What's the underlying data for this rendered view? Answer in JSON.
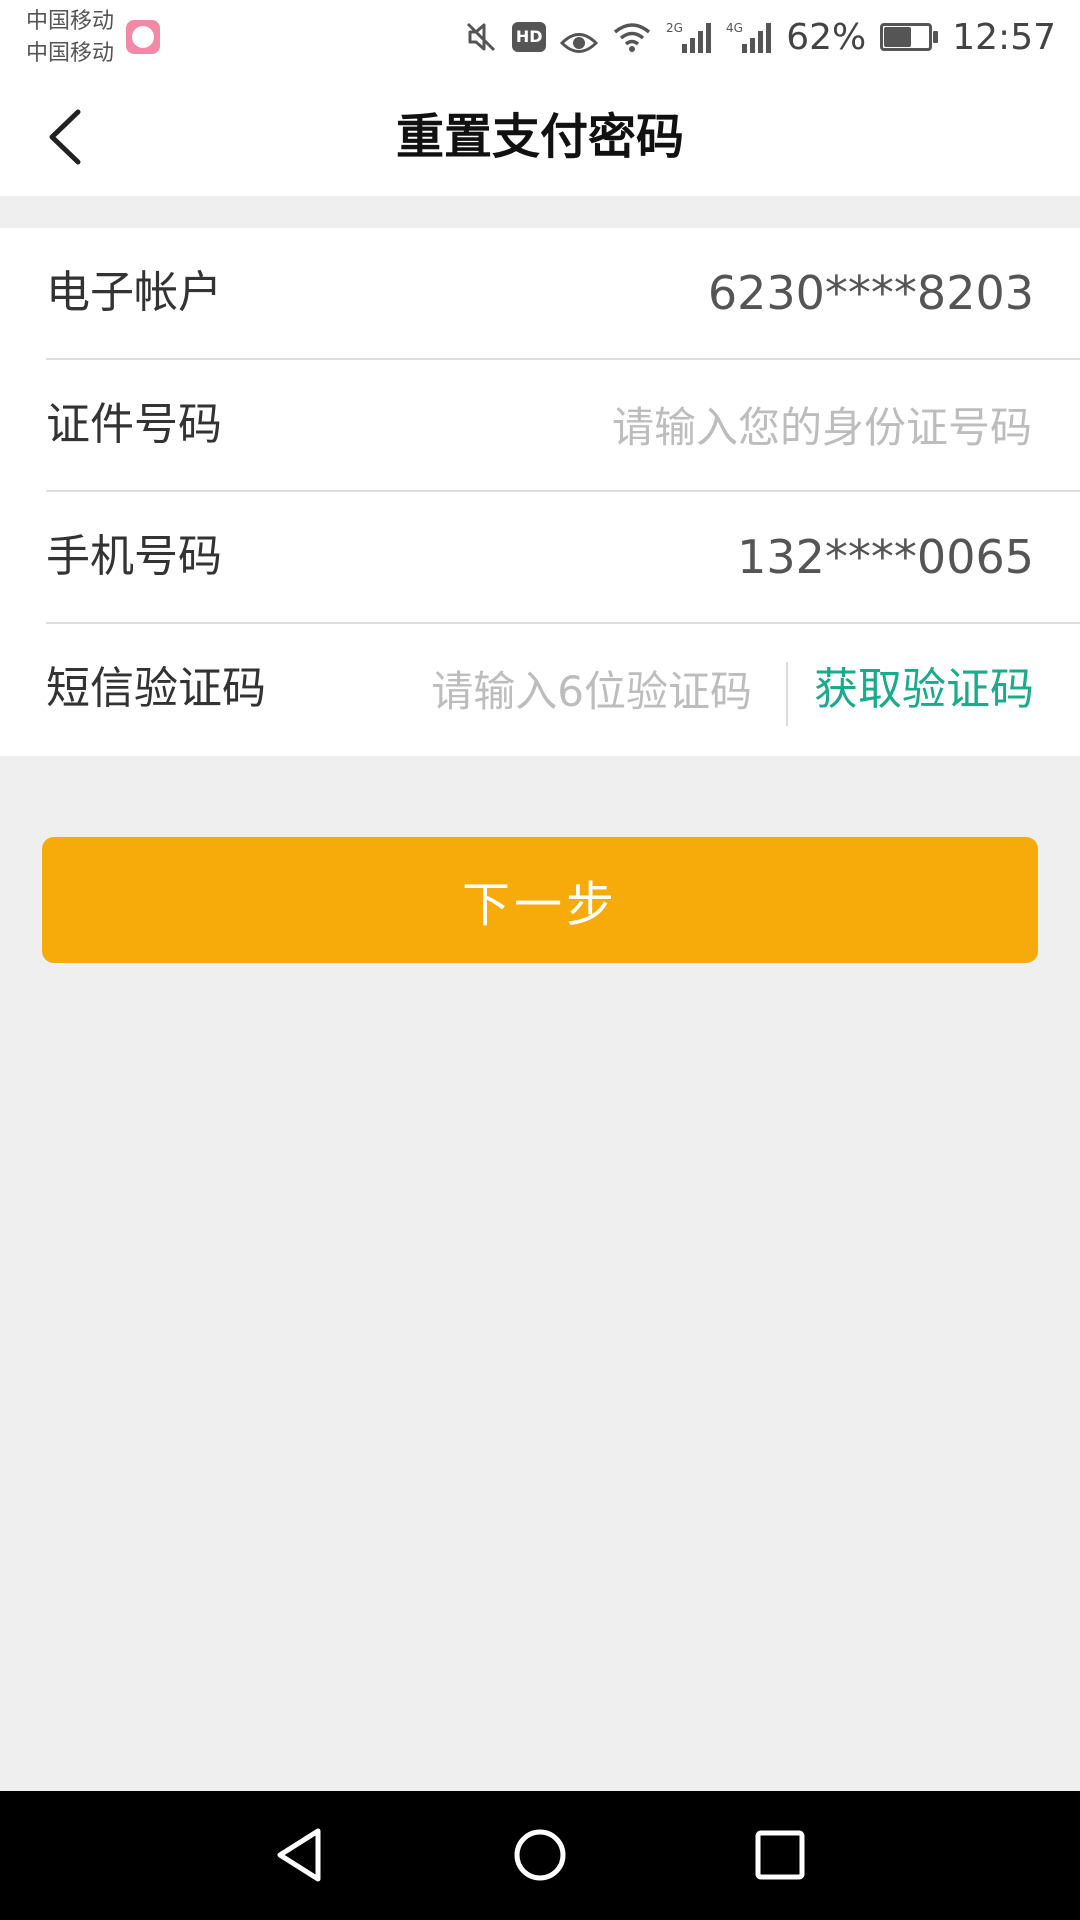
{
  "status_bar": {
    "carriers": [
      "中国移动",
      "中国移动"
    ],
    "icons": [
      "mute-icon",
      "hd-icon",
      "eye-icon",
      "wifi-icon",
      "signal-2g-icon",
      "signal-4g-icon",
      "battery-charging-icon"
    ],
    "network_2g": "2G",
    "network_4g": "4G",
    "hd_label": "HD",
    "battery_percent": "62%",
    "battery_level": 0.62,
    "time": "12:57"
  },
  "header": {
    "title": "重置支付密码",
    "back_icon": "chevron-left-icon"
  },
  "form": {
    "account": {
      "label": "电子帐户",
      "value": "6230****8203"
    },
    "id_number": {
      "label": "证件号码",
      "placeholder": "请输入您的身份证号码",
      "value": ""
    },
    "phone": {
      "label": "手机号码",
      "value": "132****0065"
    },
    "sms_code": {
      "label": "短信验证码",
      "placeholder": "请输入6位验证码",
      "value": "",
      "get_code_label": "获取验证码"
    }
  },
  "next_button": {
    "label": "下一步"
  },
  "android_nav": {
    "icons": [
      "back-triangle-icon",
      "home-circle-icon",
      "recents-square-icon"
    ]
  },
  "colors": {
    "accent": "#f7ab0a",
    "link_green": "#1aab8a",
    "background": "#efefef",
    "card": "#ffffff"
  }
}
